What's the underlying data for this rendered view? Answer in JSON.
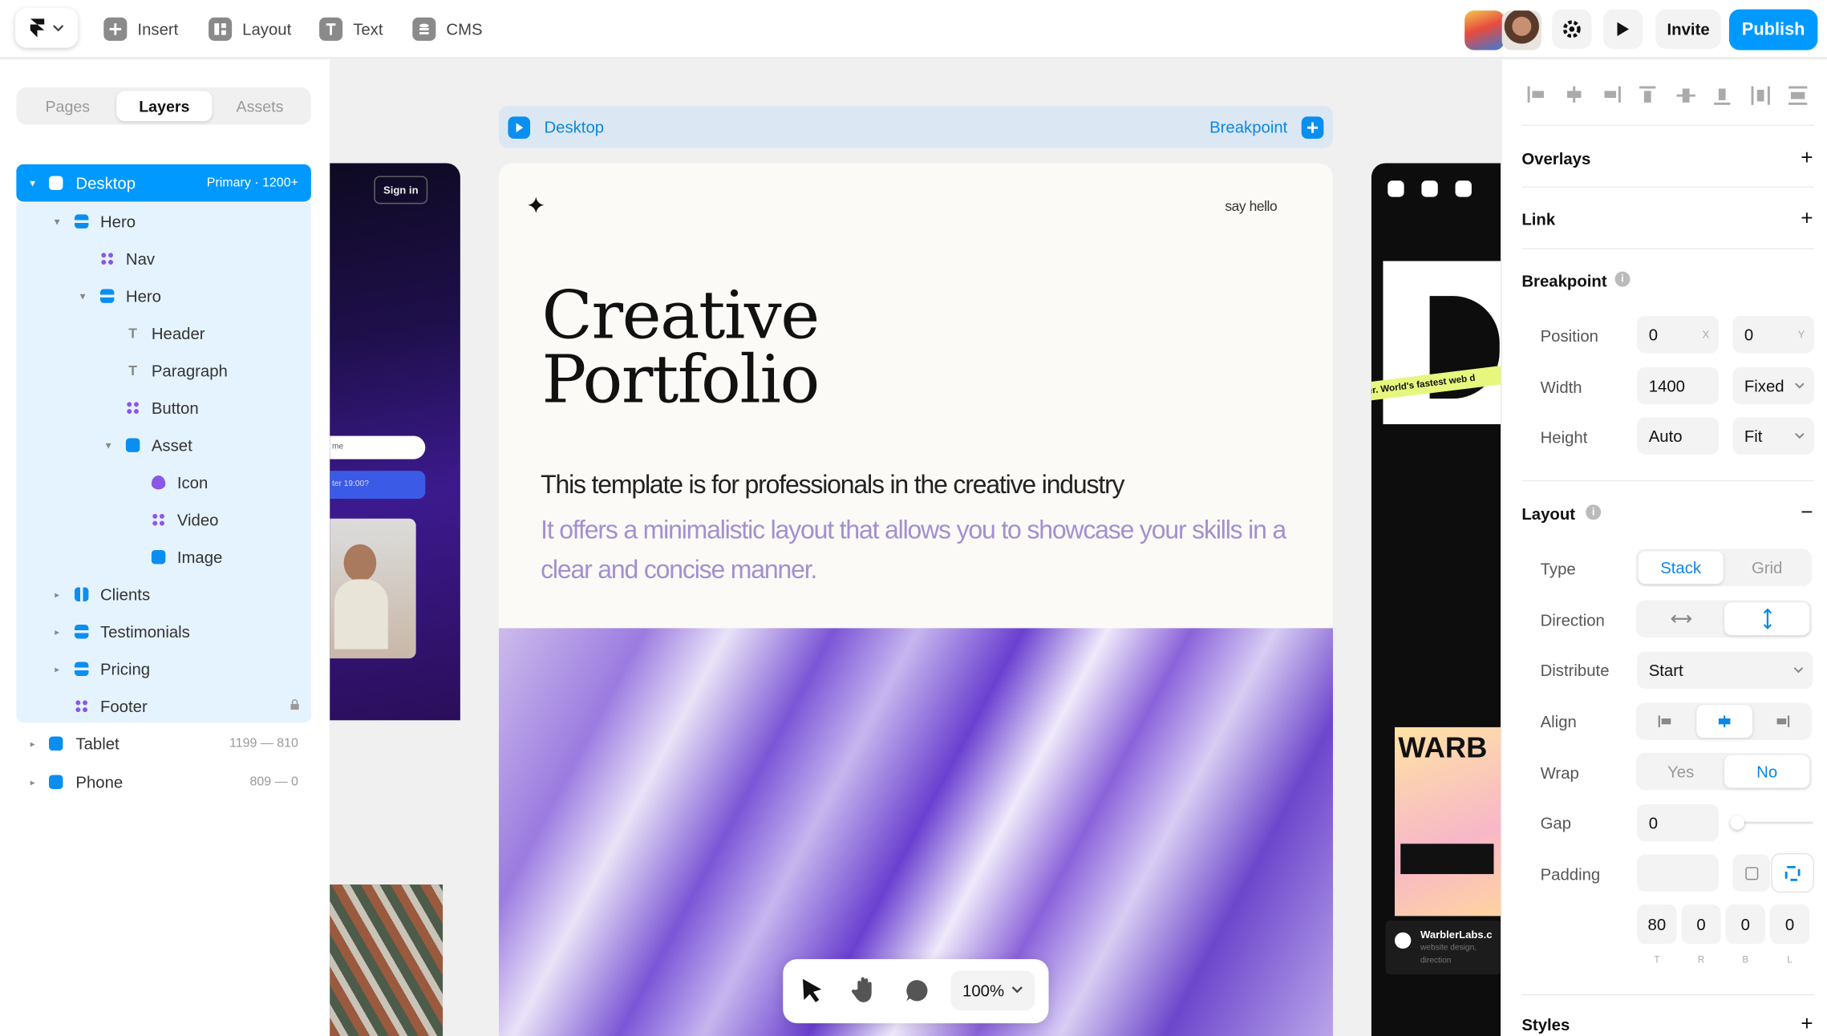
{
  "toolbar": {
    "insert": "Insert",
    "layout": "Layout",
    "text": "Text",
    "cms": "CMS",
    "invite": "Invite",
    "publish": "Publish",
    "accent": "#0099ff"
  },
  "left_panel": {
    "tabs": [
      {
        "label": "Pages",
        "active": false
      },
      {
        "label": "Layers",
        "active": true
      },
      {
        "label": "Assets",
        "active": false
      }
    ],
    "layers": [
      {
        "label": "Desktop",
        "meta": "Primary · 1200+",
        "icon": "frame-icon",
        "selected": true
      },
      {
        "label": "Hero",
        "icon": "stack-icon"
      },
      {
        "label": "Nav",
        "icon": "component-icon"
      },
      {
        "label": "Hero",
        "icon": "stack-icon"
      },
      {
        "label": "Header",
        "icon": "text-icon"
      },
      {
        "label": "Paragraph",
        "icon": "text-icon"
      },
      {
        "label": "Button",
        "icon": "component-icon"
      },
      {
        "label": "Asset",
        "icon": "frame-icon"
      },
      {
        "label": "Icon",
        "icon": "drop-icon"
      },
      {
        "label": "Video",
        "icon": "component-icon"
      },
      {
        "label": "Image",
        "icon": "frame-icon"
      },
      {
        "label": "Clients",
        "icon": "columns-icon"
      },
      {
        "label": "Testimonials",
        "icon": "stack-icon"
      },
      {
        "label": "Pricing",
        "icon": "stack-icon"
      },
      {
        "label": "Footer",
        "icon": "component-icon",
        "locked": true
      },
      {
        "label": "Tablet",
        "meta": "1199 — 810",
        "icon": "frame-icon"
      },
      {
        "label": "Phone",
        "meta": "809 — 0",
        "icon": "frame-icon"
      }
    ]
  },
  "canvas": {
    "frame_label": "Desktop",
    "breakpoint_label": "Breakpoint",
    "left_frame": {
      "sign_in": "Sign in",
      "input_1": "me",
      "input_2": "ter 19:00?"
    },
    "right_frame": {
      "tagline": "er.  World's fastest web d",
      "brand": "WARB",
      "company": "WarblerLabs.c",
      "company_sub_1": "website design,",
      "company_sub_2": "direction"
    },
    "site": {
      "say_hello": "say hello",
      "title_line1": "Creative",
      "title_line2": "Portfolio",
      "line1": "This template is for professionals in the creative industry",
      "line2": "It offers a minimalistic layout that allows you to showcase your skills in a clear and concise manner."
    },
    "zoom": "100%"
  },
  "right_panel": {
    "overlays": "Overlays",
    "link": "Link",
    "breakpoint": {
      "title": "Breakpoint",
      "position_label": "Position",
      "position_x": "0",
      "position_x_sub": "X",
      "position_y": "0",
      "position_y_sub": "Y",
      "width_label": "Width",
      "width_value": "1400",
      "width_mode": "Fixed",
      "height_label": "Height",
      "height_value": "Auto",
      "height_mode": "Fit"
    },
    "layout": {
      "title": "Layout",
      "type_label": "Type",
      "type_options": [
        "Stack",
        "Grid"
      ],
      "type_selected": "Stack",
      "direction_label": "Direction",
      "distribute_label": "Distribute",
      "distribute_value": "Start",
      "align_label": "Align",
      "wrap_label": "Wrap",
      "wrap_options": [
        "Yes",
        "No"
      ],
      "wrap_selected": "No",
      "gap_label": "Gap",
      "gap_value": "0",
      "padding_label": "Padding",
      "padding": [
        {
          "value": "80",
          "side": "T"
        },
        {
          "value": "0",
          "side": "R"
        },
        {
          "value": "0",
          "side": "B"
        },
        {
          "value": "0",
          "side": "L"
        }
      ]
    },
    "styles": "Styles"
  }
}
